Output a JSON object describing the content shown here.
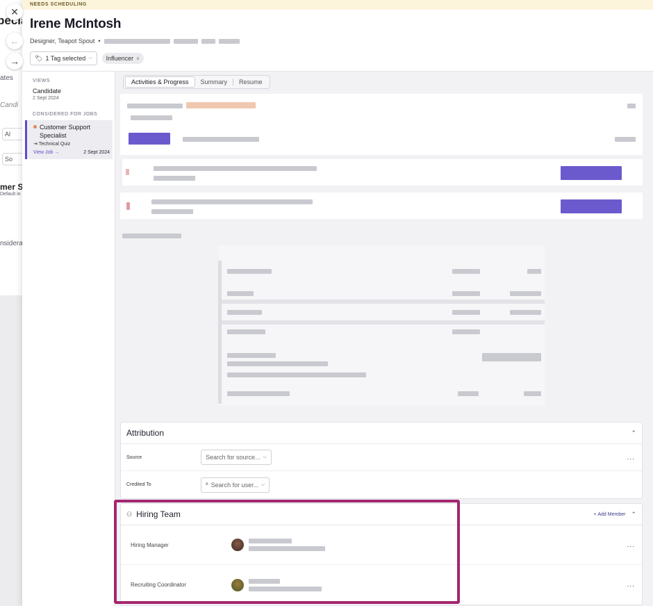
{
  "background": {
    "fragments": [
      "pecia",
      "ates",
      "Candi",
      "Al",
      "So",
      "mer S",
      "Default in",
      "nsidera"
    ]
  },
  "side_controls": {
    "close": "✕",
    "back": "←",
    "forward": "→"
  },
  "drawer": {
    "status_banner": "NEEDS SCHEDULING",
    "candidate_name": "Irene McIntosh",
    "subtitle": "Designer, Teapot Spout",
    "bullet": "•",
    "tag_selector": "1 Tag selected",
    "tags": [
      "Influencer"
    ]
  },
  "left_nav": {
    "views_label": "VIEWS",
    "views": [
      {
        "title": "Candidate",
        "date": "2 Sept 2024"
      }
    ],
    "jobs_label": "CONSIDERED FOR JOBS",
    "job": {
      "title": "Customer Support Specialist",
      "stage": "Technical Quiz",
      "view_link": "View Job →",
      "date": "2 Sept 2024"
    }
  },
  "tabs": [
    {
      "label": "Activities & Progress",
      "active": true
    },
    {
      "label": "Summary",
      "active": false
    },
    {
      "label": "Resume",
      "active": false
    }
  ],
  "attribution": {
    "title": "Attribution",
    "source_label": "Source",
    "source_placeholder": "Search for source...",
    "credited_label": "Credited To",
    "credited_placeholder": "Search for user...",
    "more": "..."
  },
  "hiring_team": {
    "title": "Hiring Team",
    "add_member": "Add Member",
    "members": [
      {
        "role": "Hiring Manager"
      },
      {
        "role": "Recruiting Coordinator"
      }
    ],
    "more": "..."
  },
  "colors": {
    "accent": "#5c4cc9",
    "highlight": "#a3266f",
    "banner": "#fdf4dc",
    "status_dot": "#e8864a"
  }
}
